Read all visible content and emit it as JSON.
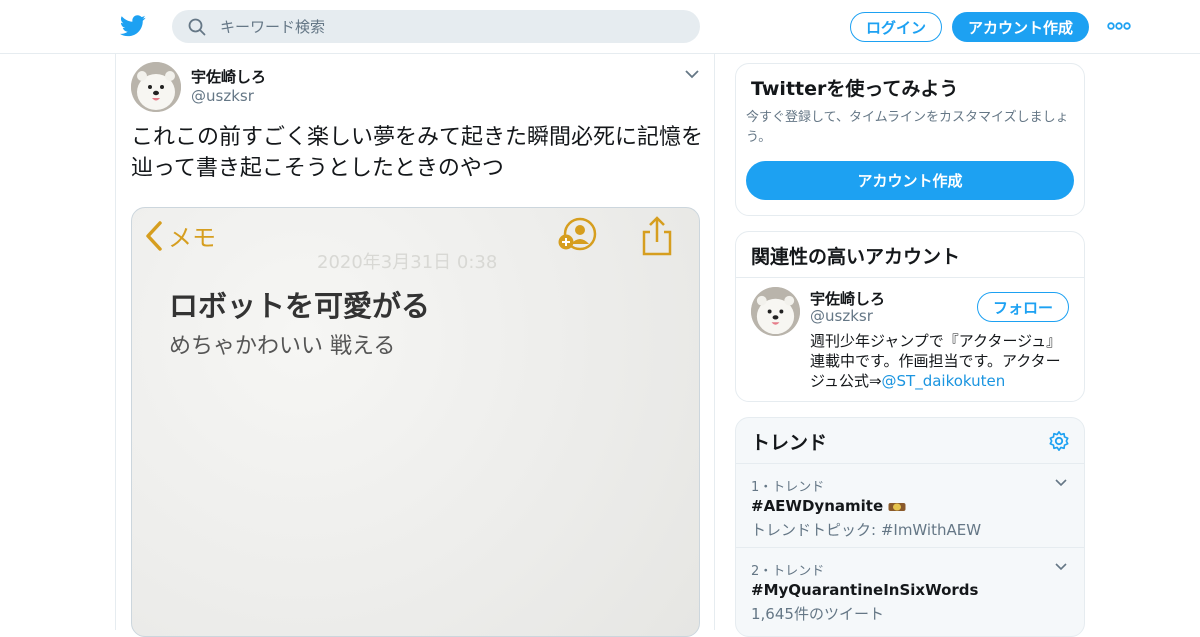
{
  "header": {
    "search_placeholder": "キーワード検索",
    "login_label": "ログイン",
    "signup_label": "アカウント作成"
  },
  "tweet": {
    "author_name": "宇佐崎しろ",
    "author_handle": "@uszksr",
    "text": "これこの前すごく楽しい夢をみて起きた瞬間必死に記憶を辿って書き起こそうとしたときのやつ",
    "media": {
      "back_label": "メモ",
      "ghost_text": "2020年3月31日 0:38",
      "note_title": "ロボットを可愛がる",
      "note_body": "めちゃかわいい 戦える"
    }
  },
  "try_card": {
    "title": "Twitterを使ってみよう",
    "description": "今すぐ登録して、タイムラインをカスタマイズしましょう。",
    "button_label": "アカウント作成"
  },
  "related_card": {
    "title": "関連性の高いアカウント",
    "account": {
      "name": "宇佐崎しろ",
      "handle": "@uszksr",
      "follow_label": "フォロー",
      "bio": "週刊少年ジャンプで『アクタージュ』連載中です。作画担当です。アクタージュ公式⇒",
      "bio_link": "@ST_daikokuten"
    }
  },
  "trends": {
    "title": "トレンド",
    "items": [
      {
        "meta": "1・トレンド",
        "name": "#AEWDynamite",
        "sub": "トレンドトピック: #ImWithAEW"
      },
      {
        "meta": "2・トレンド",
        "name": "#MyQuarantineInSixWords",
        "sub": "1,645件のツイート"
      }
    ]
  },
  "colors": {
    "accent": "#1da1f2",
    "memo_gold": "#d69e1f",
    "border": "#e6ecf0"
  }
}
